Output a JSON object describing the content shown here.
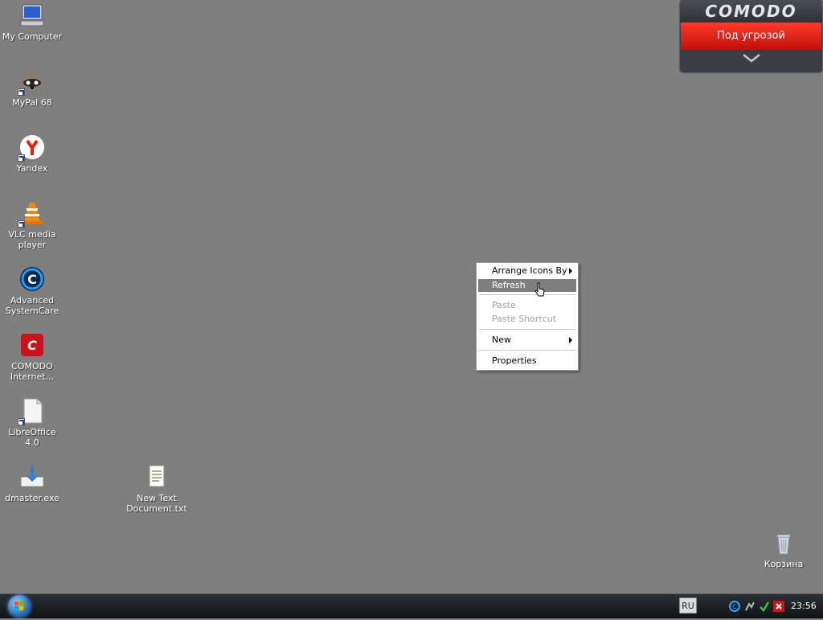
{
  "desktop": {
    "icons": [
      {
        "label": "My Computer"
      },
      {
        "label": "MyPal 68"
      },
      {
        "label": "Yandex"
      },
      {
        "label": "VLC media player"
      },
      {
        "label": "Advanced SystemCare"
      },
      {
        "label": "COMODO Internet..."
      },
      {
        "label": "LibreOffice 4.0"
      },
      {
        "label": "dmaster.exe"
      },
      {
        "label": "New Text Document.txt"
      },
      {
        "label": "Корзина"
      }
    ]
  },
  "comodo_widget": {
    "logo": "COMODO",
    "status": "Под угрозой"
  },
  "context_menu": {
    "items": [
      {
        "label": "Arrange Icons By",
        "submenu": true,
        "enabled": true
      },
      {
        "label": "Refresh",
        "submenu": false,
        "enabled": true,
        "highlighted": true
      },
      {
        "label": "Paste",
        "submenu": false,
        "enabled": false
      },
      {
        "label": "Paste Shortcut",
        "submenu": false,
        "enabled": false
      },
      {
        "label": "New",
        "submenu": true,
        "enabled": true
      },
      {
        "label": "Properties",
        "submenu": false,
        "enabled": true
      }
    ]
  },
  "taskbar": {
    "language": "RU",
    "clock": "23:56"
  },
  "colors": {
    "desktop_bg": "#7f7f7f",
    "comodo_alert": "#e0140c",
    "menu_highlight": "#7f7f7f"
  }
}
